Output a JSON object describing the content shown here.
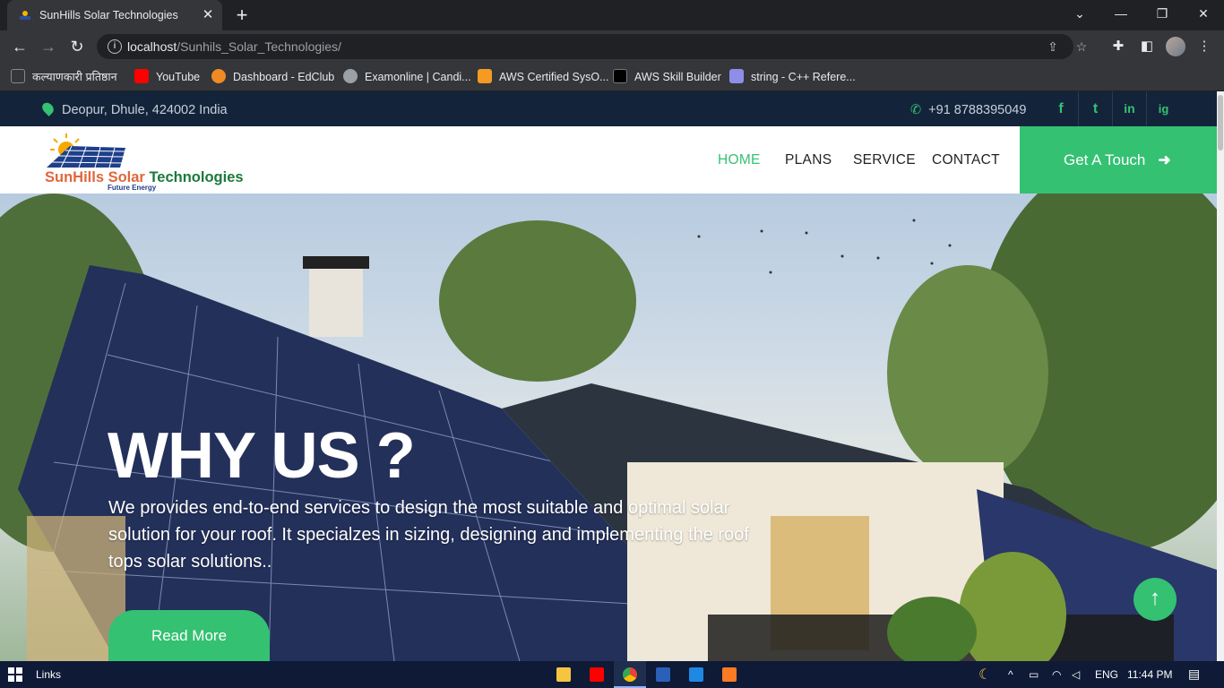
{
  "browser": {
    "tab_title": "SunHills Solar Technologies",
    "url_host": "localhost",
    "url_path": "/Sunhils_Solar_Technologies/",
    "bookmarks": [
      {
        "label": "कल्याणकारी प्रतिष्ठान",
        "color": "#6b6b6b"
      },
      {
        "label": "YouTube",
        "color": "#ff0000"
      },
      {
        "label": "Dashboard - EdClub",
        "color": "#f08a24"
      },
      {
        "label": "Examonline | Candi...",
        "color": "#9aa0a6"
      },
      {
        "label": "AWS Certified SysO...",
        "color": "#f59a23"
      },
      {
        "label": "AWS Skill Builder",
        "color": "#232f3e"
      },
      {
        "label": "string - C++ Refere...",
        "color": "#8e8ee8"
      }
    ]
  },
  "site": {
    "topbar": {
      "location": "Deopur, Dhule, 424002 India",
      "phone": "+91 8788395049",
      "social": [
        "f",
        "t",
        "in",
        "ig"
      ]
    },
    "logo": {
      "name_part1": "SunHills Solar",
      "name_part2": " Technologies",
      "tagline": "Future Energy"
    },
    "nav": [
      "HOME",
      "PLANS",
      "SERVICE",
      "CONTACT"
    ],
    "cta": "Get A Touch",
    "hero": {
      "title": "WHY US ?",
      "text": "We provides end-to-end services to design the most suitable and optimal solar solution for your roof. It specialzes in sizing, designing and implementing the roof tops solar solutions..",
      "button": "Read More"
    },
    "colors": {
      "accent": "#34c172",
      "topbar": "#13243a"
    }
  },
  "taskbar": {
    "links_label": "Links",
    "language": "ENG",
    "time": "11:44 PM"
  }
}
